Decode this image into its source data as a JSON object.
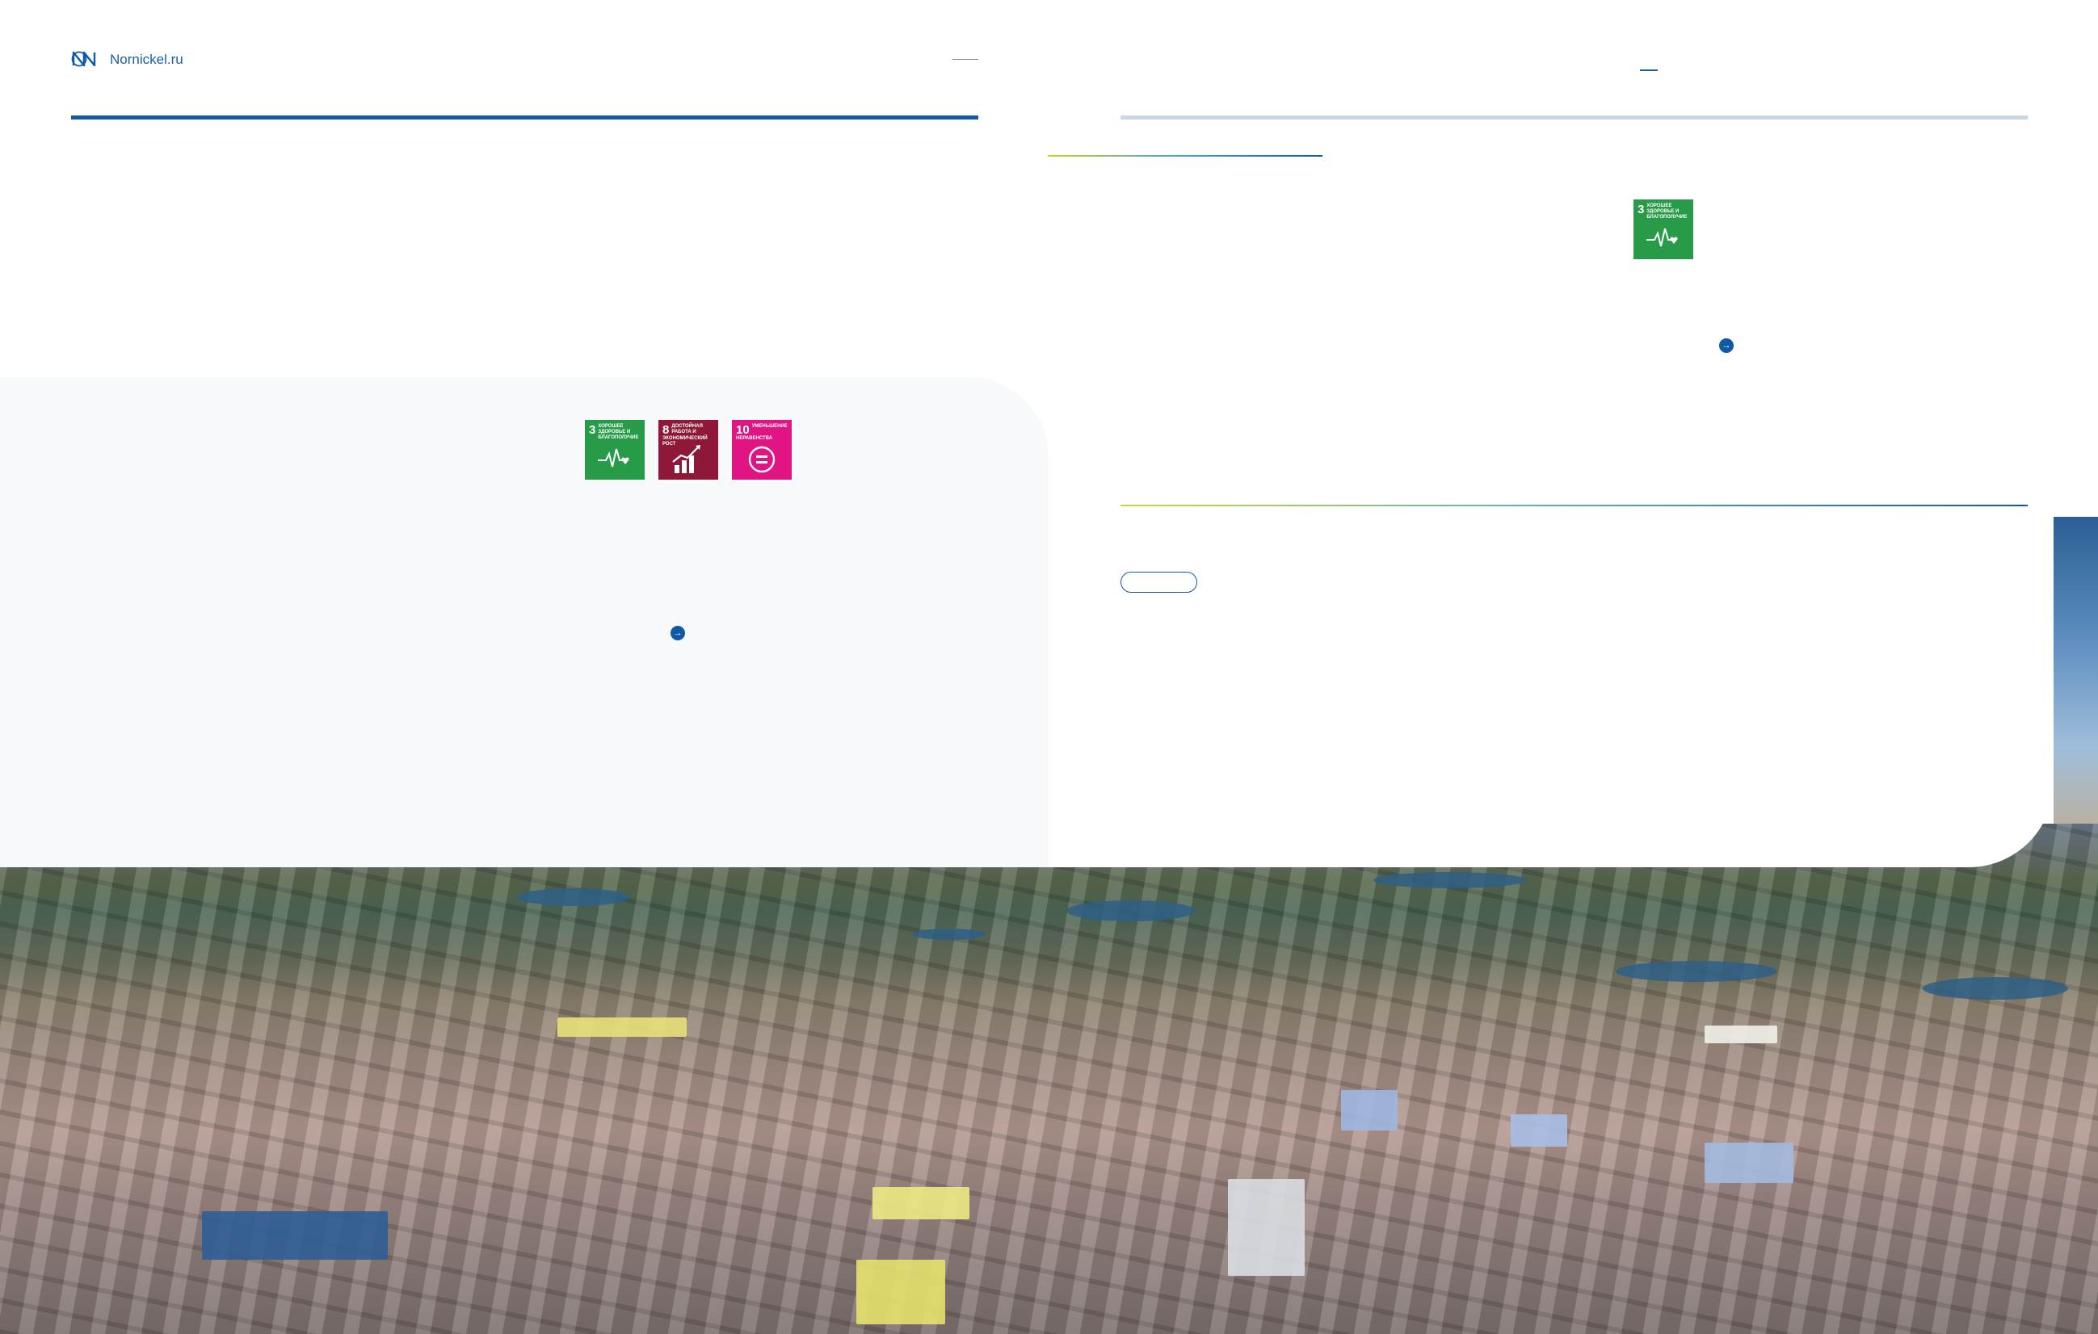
{
  "header": {
    "site_link": "Nornickel.ru",
    "logo_icon": "nornickel-logo-icon"
  },
  "sdg_tiles": {
    "goal3": {
      "number": "3",
      "label": "ХОРОШЕЕ ЗДОРОВЬЕ И БЛАГОПОЛУЧИЕ",
      "color": "#279b48",
      "icon": "heartbeat-icon"
    },
    "goal8": {
      "number": "8",
      "label": "ДОСТОЙНАЯ РАБОТА И ЭКОНОМИЧЕСКИЙ РОСТ",
      "color": "#8f1838",
      "icon": "growth-chart-icon"
    },
    "goal10": {
      "number": "10",
      "label": "УМЕНЬШЕНИЕ НЕРАВЕНСТВА",
      "color": "#e01483",
      "icon": "equality-icon"
    }
  },
  "buttons": {
    "arrow_symbol": "→",
    "pill_label": ""
  },
  "colors": {
    "brand_blue": "#0f5aa6",
    "light_rule": "#c9d6e6",
    "panel_grey": "#f7f9fb"
  }
}
